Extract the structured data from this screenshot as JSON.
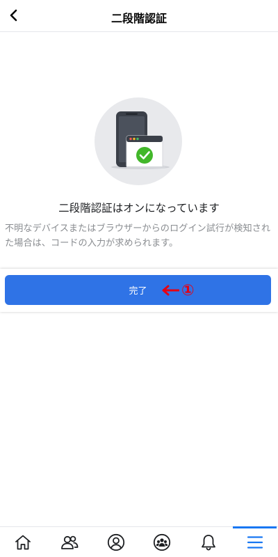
{
  "header": {
    "title": "二段階認証",
    "back_icon": "chevron-left-icon"
  },
  "illustration": {
    "icons": [
      "phone-icon",
      "browser-window-icon",
      "check-circle-icon"
    ],
    "check_color": "#42b72a"
  },
  "status": {
    "title": "二段階認証はオンになっています",
    "description": "不明なデバイスまたはブラウザーからのログイン試行が検知された場合は、コードの入力が求められます。"
  },
  "done_button": {
    "label": "完了",
    "color": "#2f73e6"
  },
  "annotation": {
    "number": "①",
    "color": "#e60012"
  },
  "tabbar": {
    "tabs": [
      {
        "icon": "home-icon",
        "active": false
      },
      {
        "icon": "friends-icon",
        "active": false
      },
      {
        "icon": "profile-icon",
        "active": false
      },
      {
        "icon": "groups-icon",
        "active": false
      },
      {
        "icon": "bell-icon",
        "active": false
      },
      {
        "icon": "menu-icon",
        "active": true
      }
    ],
    "active_color": "#1877f2"
  }
}
